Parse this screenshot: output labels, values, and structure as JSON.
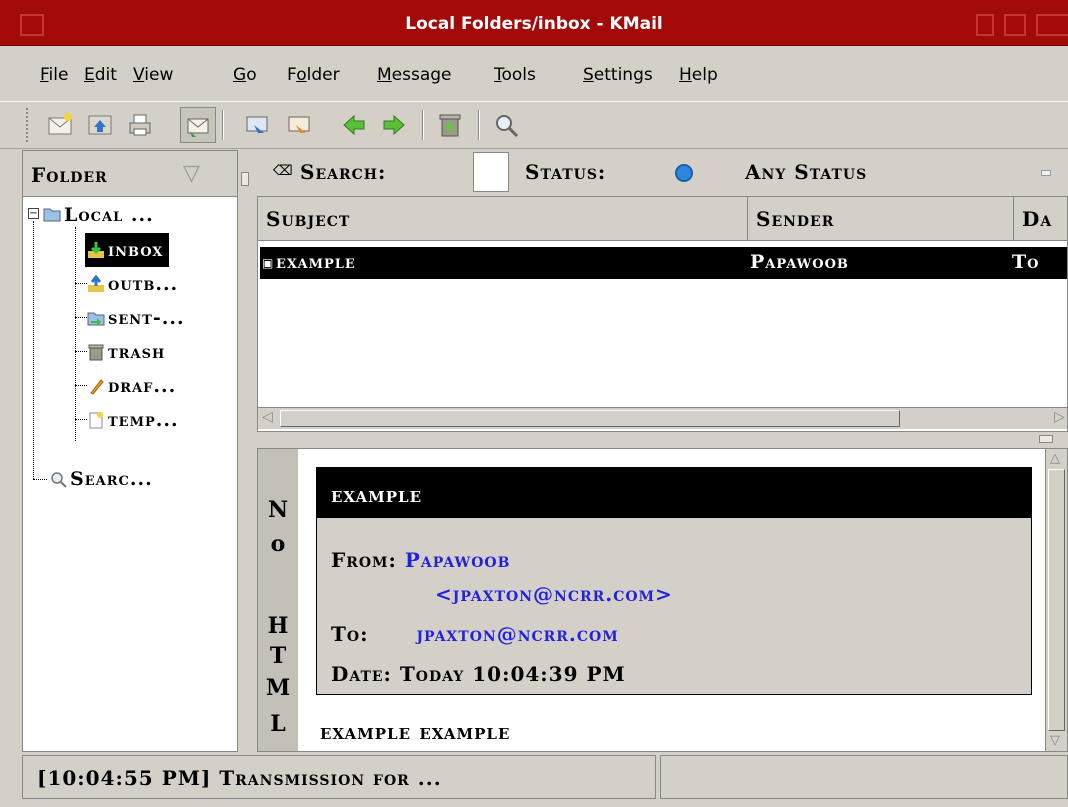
{
  "window": {
    "title": "Local Folders/inbox - KMail",
    "accent_color": "#a30a0a"
  },
  "menu": {
    "items": [
      {
        "label": "File",
        "mnemonic": "F",
        "rest": "ile"
      },
      {
        "label": "Edit",
        "mnemonic": "E",
        "rest": "dit"
      },
      {
        "label": "View",
        "mnemonic": "V",
        "rest": "iew"
      },
      {
        "label": "Go",
        "mnemonic": "G",
        "rest": "o"
      },
      {
        "label": "Folder",
        "pre": "F",
        "mnemonic": "o",
        "rest": "lder"
      },
      {
        "label": "Message",
        "mnemonic": "M",
        "rest": "essage"
      },
      {
        "label": "Tools",
        "mnemonic": "T",
        "rest": "ools"
      },
      {
        "label": "Settings",
        "mnemonic": "S",
        "rest": "ettings"
      },
      {
        "label": "Help",
        "mnemonic": "H",
        "rest": "elp"
      }
    ]
  },
  "toolbar": {
    "buttons": [
      {
        "name": "new-message",
        "icon": "new-message-icon"
      },
      {
        "name": "reply",
        "icon": "reply-icon"
      },
      {
        "name": "print",
        "icon": "printer-icon"
      },
      {
        "name": "check-mail",
        "icon": "check-mail-icon"
      },
      {
        "name": "forward",
        "icon": "forward-icon"
      },
      {
        "name": "reply-all",
        "icon": "reply-all-icon"
      },
      {
        "name": "previous",
        "icon": "green-left-arrow-icon"
      },
      {
        "name": "next",
        "icon": "green-right-arrow-icon"
      },
      {
        "name": "trash",
        "icon": "trash-can-icon"
      },
      {
        "name": "find",
        "icon": "magnifier-icon"
      }
    ]
  },
  "folders": {
    "header": "Folder",
    "items": [
      {
        "label": "Local ...",
        "icon": "folder-icon"
      },
      {
        "label": "inbox",
        "icon": "inbox-icon"
      },
      {
        "label": "outb...",
        "icon": "outbox-icon"
      },
      {
        "label": "sent-...",
        "icon": "sent-mail-icon"
      },
      {
        "label": "trash",
        "icon": "trash-icon"
      },
      {
        "label": "draf...",
        "icon": "drafts-icon"
      },
      {
        "label": "temp...",
        "icon": "templates-icon"
      },
      {
        "label": "Searc...",
        "icon": "search-folder-icon"
      }
    ]
  },
  "search": {
    "label": "Search:",
    "value": "",
    "status_label": "Status:",
    "status_mnemonic": "U",
    "status_value": "Any Status"
  },
  "messages": {
    "columns": [
      "Subject",
      "Sender",
      "Da"
    ],
    "rows": [
      {
        "subject": "example",
        "sender": "Papawoob",
        "date": "To"
      }
    ]
  },
  "reader": {
    "side_label": [
      "N",
      "o",
      "",
      "H",
      "T",
      "M",
      "L"
    ],
    "subject": "example",
    "from_label": "From:",
    "from_name": "Papawoob",
    "from_email": "<jpaxton@ncrr.com>",
    "to_label": "To:",
    "to_value": "jpaxton@ncrr.com",
    "date_label": "Date:",
    "date_value": "Today 10:04:39 PM",
    "body": "example example"
  },
  "status": {
    "message": "[10:04:55 PM] Transmission for ..."
  }
}
